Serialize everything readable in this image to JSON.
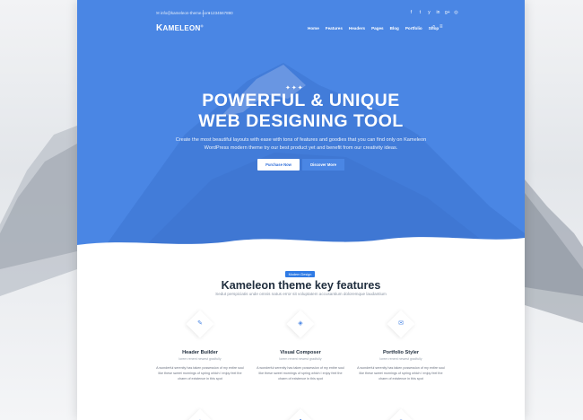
{
  "topbar": {
    "email": "✉ info@kameleon-theme.com",
    "phone": "+1234567890",
    "socials": [
      "f",
      "t",
      "y",
      "in",
      "g+",
      "◎"
    ]
  },
  "nav": {
    "logo_letter": "K",
    "logo_rest": "AMELEON",
    "logo_mark": "®",
    "menu": [
      "Home",
      "Features",
      "Headers",
      "Pages",
      "Blog",
      "Portfolio",
      "Shop"
    ],
    "search_icon": "search-icon",
    "menu_icon": "hamburger-icon"
  },
  "hero": {
    "ornament": "✦✦✦",
    "title_line1": "POWERFUL & UNIQUE",
    "title_line2": "WEB DESIGNING TOOL",
    "subtitle": "Create the most beautiful layouts with ease with tons of features and goodies that you can find only on Kameleon WordPress modern theme try our best product yet and benefit from our creativity ideas.",
    "primary_button": "Purchase Now",
    "secondary_button": "Discover More",
    "background_color": "#4a86e4"
  },
  "features": {
    "badge": "Modern Design",
    "title": "Kameleon theme key features",
    "subtitle": "Sedut perspiciatis unde omnis natus error sit voluptatem accusantium doloremque laudantium",
    "items": [
      {
        "icon": "✎",
        "name": "Header Builder",
        "tagline": "lorem renent newest gradfully",
        "description": "A wonderful serenity has taken possession of my entire soul like these sweet mornings of spring which I enjoy feel the charm of existence in this spot"
      },
      {
        "icon": "◈",
        "name": "Visual Composer",
        "tagline": "lorem renent newest gradfully",
        "description": "A wonderful serenity has taken possession of my entire soul like these sweet mornings of spring which I enjoy feel the charm of existence in this spot"
      },
      {
        "icon": "✉",
        "name": "Portfolio Styler",
        "tagline": "lorem renent newest gradfully",
        "description": "A wonderful serenity has taken possession of my entire soul like these sweet mornings of spring which I enjoy feel the charm of existence in this spot"
      }
    ],
    "second_row_icons": [
      "◇",
      "✿",
      "◎"
    ]
  }
}
